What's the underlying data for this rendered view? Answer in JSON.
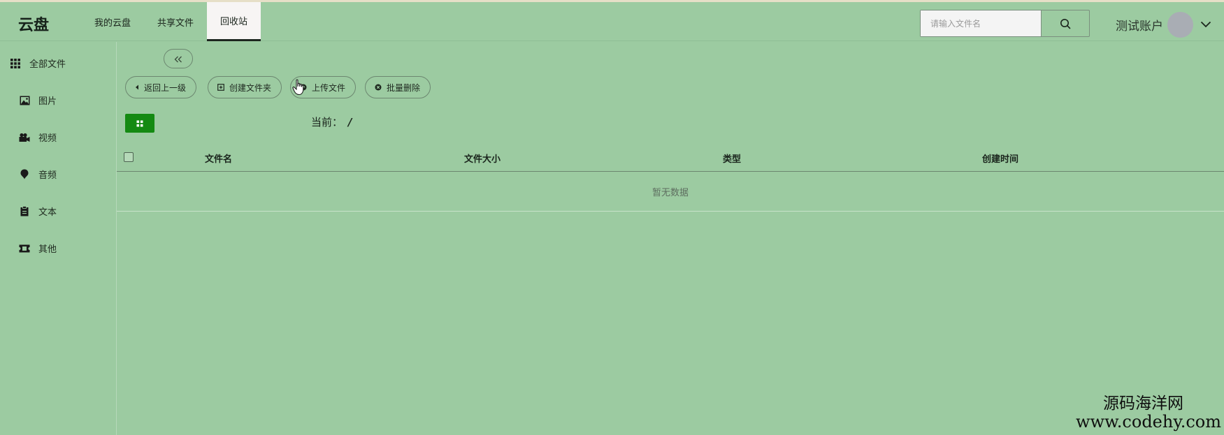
{
  "app": {
    "logo": "云盘"
  },
  "nav": {
    "items": [
      {
        "label": "我的云盘"
      },
      {
        "label": "共享文件"
      },
      {
        "label": "回收站",
        "active": true
      }
    ]
  },
  "search": {
    "placeholder": "请输入文件名",
    "value": ""
  },
  "account": {
    "name": "测试账户"
  },
  "sidebar": {
    "items": [
      {
        "label": "全部文件",
        "icon": "grid-icon"
      },
      {
        "label": "图片",
        "icon": "image-icon"
      },
      {
        "label": "视频",
        "icon": "video-camera-icon"
      },
      {
        "label": "音频",
        "icon": "audio-icon"
      },
      {
        "label": "文本",
        "icon": "clipboard-icon"
      },
      {
        "label": "其他",
        "icon": "ticket-icon"
      }
    ]
  },
  "toolbar": {
    "back_label": "返回上一级",
    "new_folder_label": "创建文件夹",
    "upload_label": "上传文件",
    "batch_delete_label": "批量删除"
  },
  "path": {
    "label": "当前：",
    "value": "/"
  },
  "table": {
    "columns": [
      "文件名",
      "文件大小",
      "类型",
      "创建时间"
    ],
    "empty_text": "暂无数据"
  },
  "watermark": {
    "name": "源码海洋网",
    "url": "www.codehy.com"
  },
  "colors": {
    "background": "#9ccba1",
    "active_tab": "#f7f5f4",
    "grid_button": "#148a12"
  }
}
